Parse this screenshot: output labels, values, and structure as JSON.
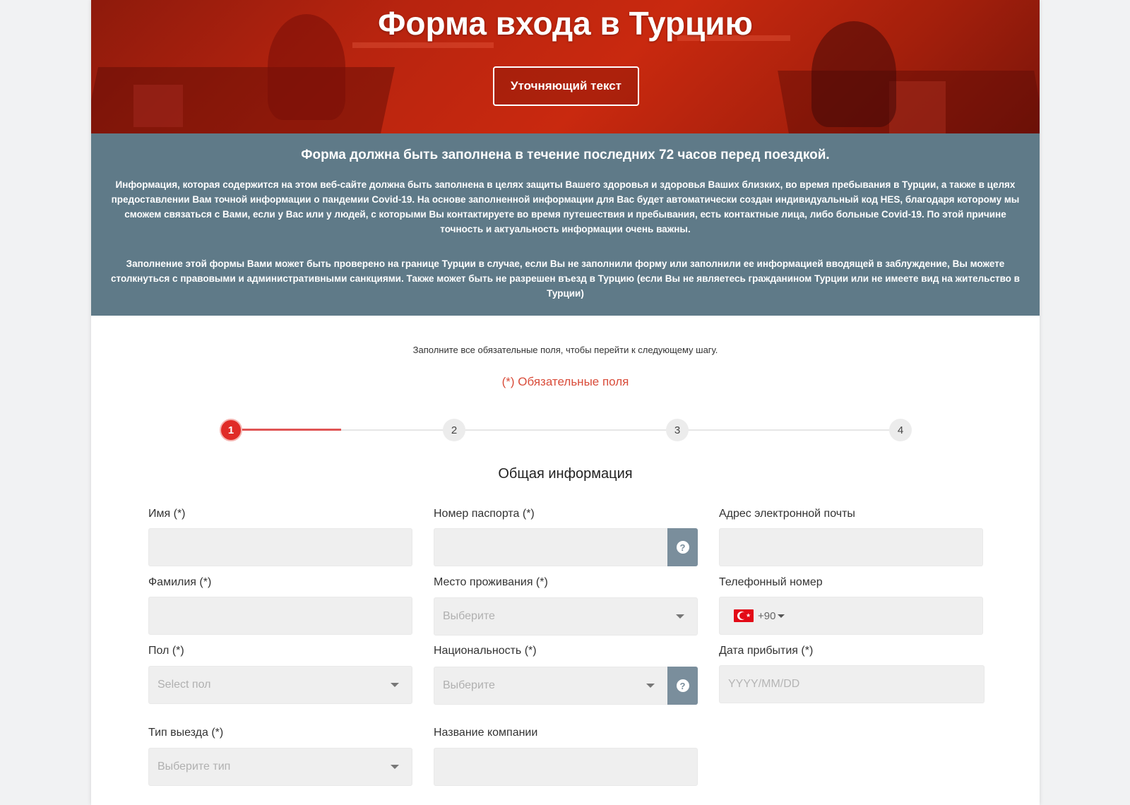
{
  "hero": {
    "title": "Форма входа в Турцию",
    "button_label": "Уточняющий текст"
  },
  "info": {
    "title": "Форма должна быть заполнена в течение последних 72 часов перед поездкой.",
    "paragraph1": "Информация, которая содержится на этом веб-сайте должна быть заполнена в целях защиты Вашего здоровья и здоровья Ваших близких, во время пребывания в Турции, а также в целях предоставлении Вам точной информации о пандемии Covid-19. На основе заполненной информации для Вас будет автоматически создан индивидуальный код HES, благодаря которому мы сможем связаться с Вами, если у Вас или у людей, с которыми Вы контактируете во время путешествия и пребывания, есть контактные лица, либо больные Covid-19. По этой причине точность и актуальность информации очень важны.",
    "paragraph2": "Заполнение этой формы Вами может быть проверено на границе Турции в случае, если Вы не заполнили форму или заполнили ее информацией вводящей в заблуждение, Вы можете столкнуться с правовыми и административными санкциями. Также может быть не разрешен въезд в Турцию (если Вы не являетесь гражданином Турции или не имеете вид на жительство в Турции)"
  },
  "form": {
    "hint": "Заполните все обязательные поля, чтобы перейти к следующему шагу.",
    "required_note": "(*) Обязательные поля",
    "steps": [
      "1",
      "2",
      "3",
      "4"
    ],
    "active_step": 1,
    "section_title": "Общая информация",
    "fields": {
      "first_name": {
        "label": "Имя (*)",
        "value": ""
      },
      "passport": {
        "label": "Номер паспорта (*)",
        "value": "",
        "help": "?"
      },
      "email": {
        "label": "Адрес электронной почты",
        "value": ""
      },
      "last_name": {
        "label": "Фамилия (*)",
        "value": ""
      },
      "residence": {
        "label": "Место проживания (*)",
        "placeholder": "Выберите"
      },
      "phone": {
        "label": "Телефонный номер",
        "dial_code": "+90",
        "country_flag": "turkey-flag-icon"
      },
      "gender": {
        "label": "Пол (*)",
        "placeholder": "Select пол"
      },
      "nationality": {
        "label": "Национальность (*)",
        "placeholder": "Выберите",
        "help": "?"
      },
      "arrival_date": {
        "label": "Дата прибытия (*)",
        "placeholder": "YYYY/MM/DD"
      },
      "departure_type": {
        "label": "Тип выезда (*)",
        "placeholder": "Выберите тип"
      },
      "company_name": {
        "label": "Название компании",
        "value": ""
      }
    }
  },
  "colors": {
    "hero_red": "#c9290f",
    "info_band": "#5f7a88",
    "required_red": "#d94c3a",
    "step_active": "#e02b27",
    "help_button": "#7a8e9c",
    "input_bg": "#efefef"
  }
}
